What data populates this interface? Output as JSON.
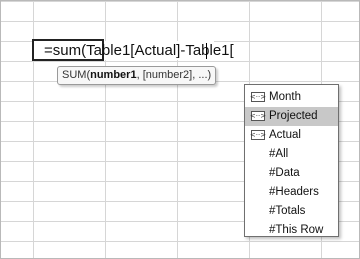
{
  "formula": {
    "prefix": "=sum(",
    "rest": "Table1[Actual]-Table1["
  },
  "tooltip": {
    "fn": "SUM(",
    "arg1": "number1",
    "rest": ", [number2], ...)"
  },
  "dropdown": {
    "items": [
      {
        "label": "Month",
        "icon": "table-column-icon",
        "icon_glyph": "<··>",
        "selected": false
      },
      {
        "label": "Projected",
        "icon": "table-column-icon",
        "icon_glyph": "<··>",
        "selected": true
      },
      {
        "label": "Actual",
        "icon": "table-column-icon",
        "icon_glyph": "<··>",
        "selected": false
      },
      {
        "label": "#All",
        "icon": "",
        "selected": false
      },
      {
        "label": "#Data",
        "icon": "",
        "selected": false
      },
      {
        "label": "#Headers",
        "icon": "",
        "selected": false
      },
      {
        "label": "#Totals",
        "icon": "",
        "selected": false
      },
      {
        "label": "#This Row",
        "icon": "",
        "selected": false
      }
    ]
  }
}
